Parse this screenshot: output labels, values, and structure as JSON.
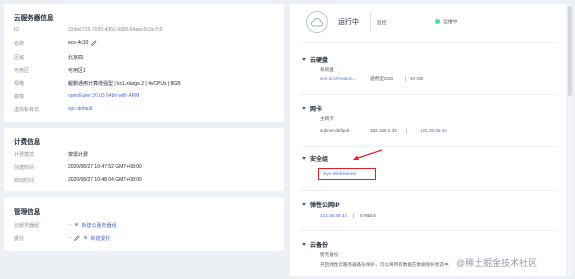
{
  "server_info": {
    "title": "云服务器信息",
    "rows": [
      {
        "label": "ID",
        "value": "22de6715-7035-436c-9d05-64aec5c3e7c5"
      },
      {
        "label": "名称",
        "value": "ecs-4c10"
      },
      {
        "label": "区域",
        "value": "北京四"
      },
      {
        "label": "可用区",
        "value": "可用区1"
      },
      {
        "label": "规格",
        "value": "鲲鹏通用计算增强型 | kc1.xlarge.2 | 4vCPUs | 8GB"
      },
      {
        "label": "镜像",
        "value": "openEuler 20.03 64bit with ARM"
      },
      {
        "label": "虚拟私有云",
        "value": "vpc-default"
      }
    ]
  },
  "billing": {
    "title": "计费信息",
    "rows": [
      {
        "label": "计费模式",
        "value": "按需计费"
      },
      {
        "label": "创建时间",
        "value": "2020/08/27 10:47:52 GMT+08:00"
      },
      {
        "label": "启动时间",
        "value": "2020/08/27 10:48:04 GMT+08:00"
      }
    ]
  },
  "management": {
    "title": "管理信息",
    "rows": [
      {
        "label": "云服务器组",
        "dash": "--",
        "action": "新建云服务器组"
      },
      {
        "label": "委托",
        "dash": "--",
        "action": "新建委托"
      }
    ]
  },
  "status": {
    "text": "运行中",
    "tag_label": "监控",
    "monitor_label": "运维中",
    "colors": {
      "running": "#50d4ab"
    }
  },
  "disk": {
    "title": "云硬盘",
    "system_label": "系统盘",
    "disk_name": "ecs-4c10-volum...",
    "disk_type": "通用型SSD",
    "disk_size": "40 GB"
  },
  "nic": {
    "title": "网卡",
    "primary_label": "主网卡",
    "subnet": "subnet-default",
    "private_ip": "192.168.0.34",
    "public_ip": "121.36.69.34"
  },
  "security_group": {
    "title": "安全组",
    "name": "Sys-WebServer"
  },
  "eip": {
    "title": "弹性公网IP",
    "ip": "121.36.69.34",
    "bandwidth": "5 Mbit/s"
  },
  "backup": {
    "title": "云备份",
    "subtitle": "暂无备份",
    "description": "开启弹性云服务器备份保护，可以将所有数据在数据保护状态中...备份您的数据。"
  },
  "watermark": {
    "text": "@稀土掘金技术社区"
  }
}
